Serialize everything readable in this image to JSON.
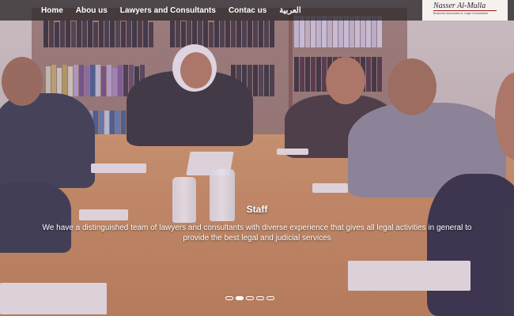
{
  "nav": {
    "items": [
      {
        "label": "Home"
      },
      {
        "label": "Abou us"
      },
      {
        "label": "Lawyers and Consultants"
      },
      {
        "label": "Contac us"
      },
      {
        "label": "العربية"
      }
    ]
  },
  "logo": {
    "brand": "Nasser   Al-Mulla",
    "tagline": "Business Advocates & Legal Consultants"
  },
  "slide": {
    "title": "Staff",
    "text": "We have a distinguished team of lawyers and consultants with diverse experience that gives all legal activities in general to provide the best legal and judicial services"
  },
  "carousel": {
    "count": 5,
    "active_index": 1
  }
}
